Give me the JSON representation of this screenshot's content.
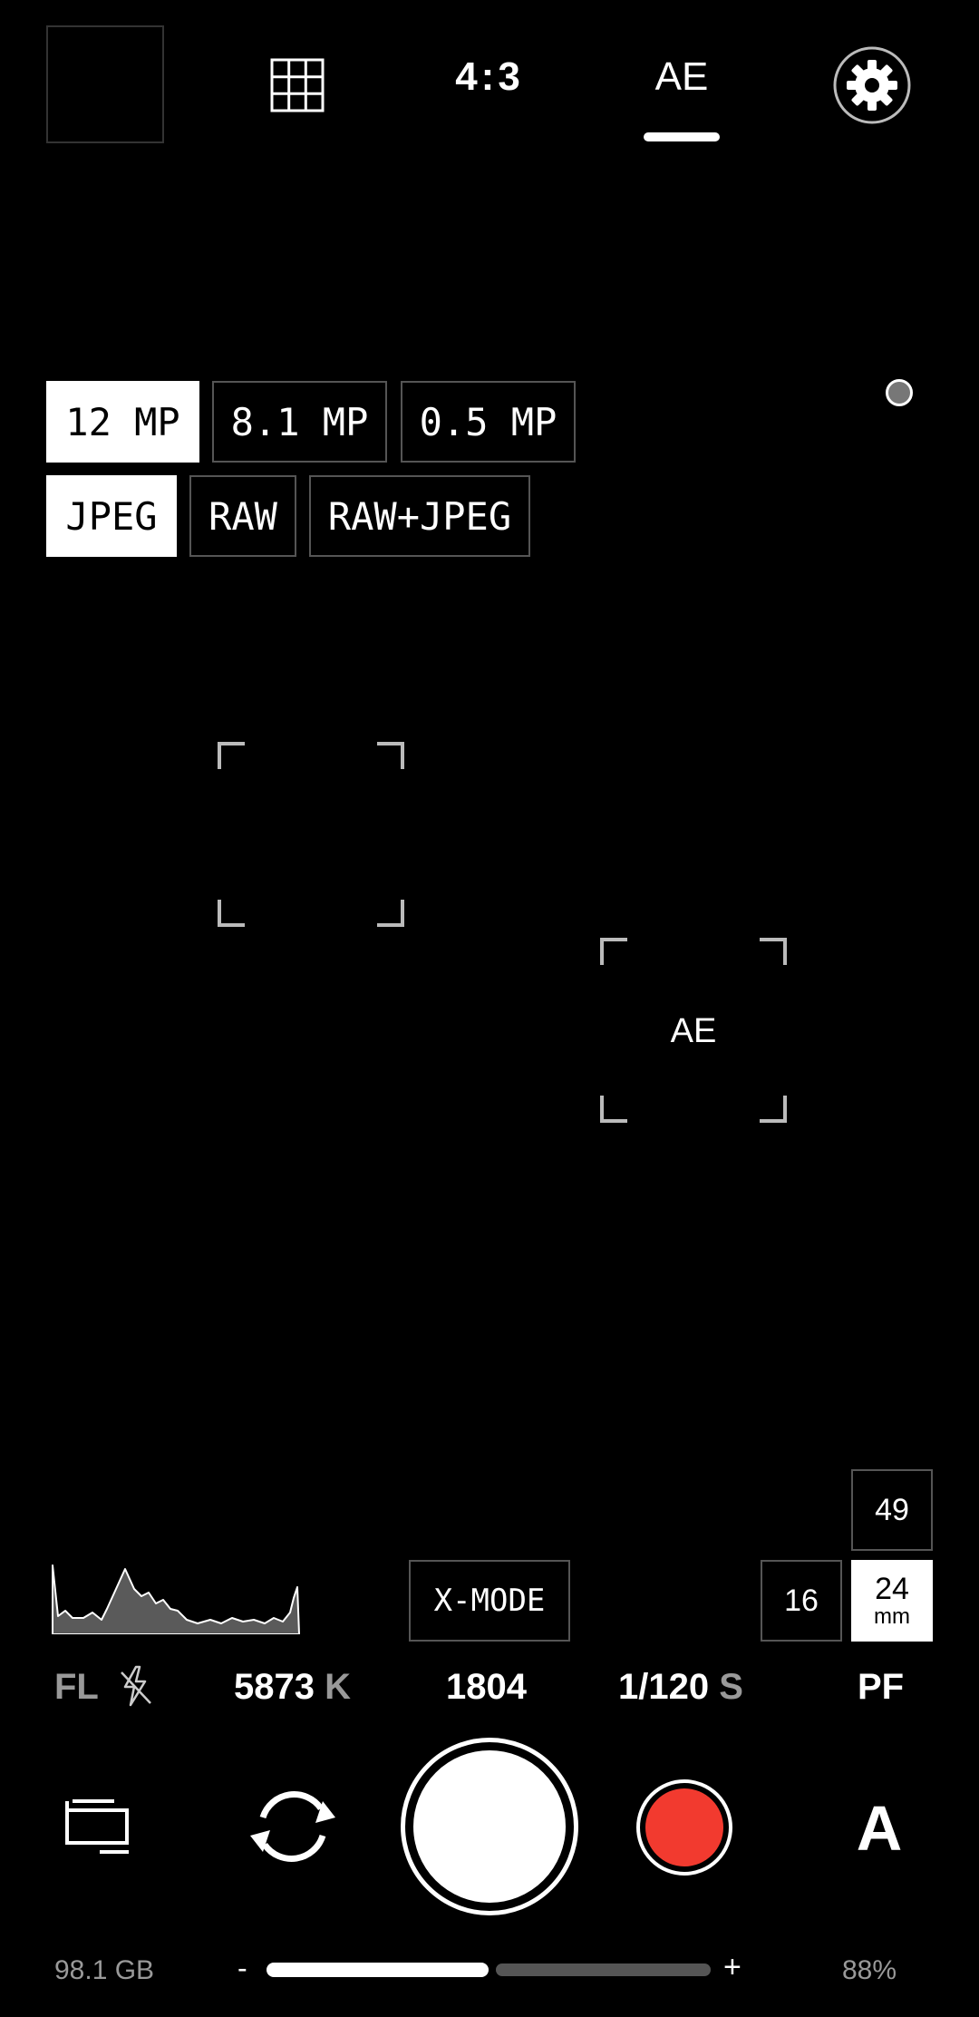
{
  "top_bar": {
    "aspect_ratio": "4:3",
    "mode_tab": "AE"
  },
  "resolution": {
    "options": [
      "12 MP",
      "8.1 MP",
      "0.5 MP"
    ],
    "selected": "12 MP"
  },
  "format": {
    "options": [
      "JPEG",
      "RAW",
      "RAW+JPEG"
    ],
    "selected": "JPEG"
  },
  "focus": {
    "ae_label": "AE"
  },
  "lenses": {
    "upper": "49",
    "wide": "16",
    "main": "24",
    "unit": "mm",
    "selected": "24"
  },
  "xmode_label": "X-MODE",
  "info_row": {
    "focus_mode": "FL",
    "white_balance_value": "5873",
    "white_balance_unit": "K",
    "iso": "1804",
    "shutter_value": "1/120",
    "shutter_unit": "S",
    "profile": "PF"
  },
  "controls": {
    "exposure_mode": "A"
  },
  "status": {
    "storage": "98.1 GB",
    "battery": "88%",
    "zoom_minus": "-",
    "zoom_plus": "+",
    "zoom_level_fraction": 0.5
  },
  "colors": {
    "record": "#f23a2f",
    "selected_chip": "#ffffff"
  }
}
